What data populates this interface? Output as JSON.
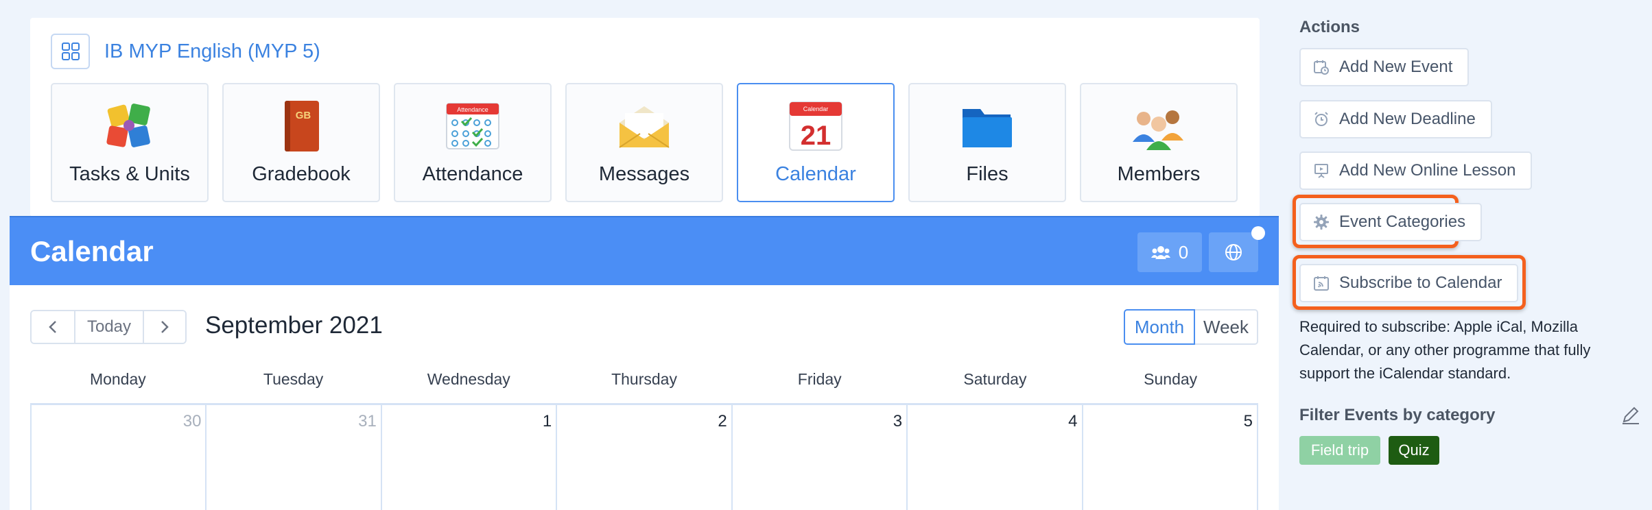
{
  "course": {
    "title": "IB MYP English (MYP 5)",
    "tools": [
      {
        "label": "Tasks & Units",
        "icon": "puzzle-icon"
      },
      {
        "label": "Gradebook",
        "icon": "gradebook-icon",
        "badge": "GB"
      },
      {
        "label": "Attendance",
        "icon": "attendance-icon",
        "badge": "Attendance"
      },
      {
        "label": "Messages",
        "icon": "envelope-icon"
      },
      {
        "label": "Calendar",
        "icon": "calendar-icon",
        "badge": "Calendar",
        "day": "21",
        "active": true
      },
      {
        "label": "Files",
        "icon": "folder-icon"
      },
      {
        "label": "Members",
        "icon": "members-icon"
      }
    ]
  },
  "calendar_header": {
    "title": "Calendar",
    "members_count": "0"
  },
  "calendar": {
    "today_label": "Today",
    "month_title": "September 2021",
    "views": {
      "month": "Month",
      "week": "Week"
    },
    "weekdays": [
      "Monday",
      "Tuesday",
      "Wednesday",
      "Thursday",
      "Friday",
      "Saturday",
      "Sunday"
    ],
    "days": [
      {
        "num": "30",
        "muted": true
      },
      {
        "num": "31",
        "muted": true
      },
      {
        "num": "1",
        "muted": false
      },
      {
        "num": "2",
        "muted": false
      },
      {
        "num": "3",
        "muted": false
      },
      {
        "num": "4",
        "muted": false
      },
      {
        "num": "5",
        "muted": false
      }
    ]
  },
  "actions": {
    "title": "Actions",
    "add_event": "Add New Event",
    "add_deadline": "Add New Deadline",
    "add_online_lesson": "Add New Online Lesson",
    "event_categories": "Event Categories",
    "subscribe": "Subscribe to Calendar",
    "required_text": "Required to subscribe: Apple iCal, Mozilla Calendar, or any other programme that fully support the iCalendar standard.",
    "filter_title": "Filter Events by category",
    "categories": [
      "Field trip",
      "Quiz"
    ]
  },
  "colors": {
    "accent": "#4b8ef5",
    "highlight": "#f4601d",
    "field_trip": "#8fd1a4",
    "quiz": "#1e5c12"
  }
}
